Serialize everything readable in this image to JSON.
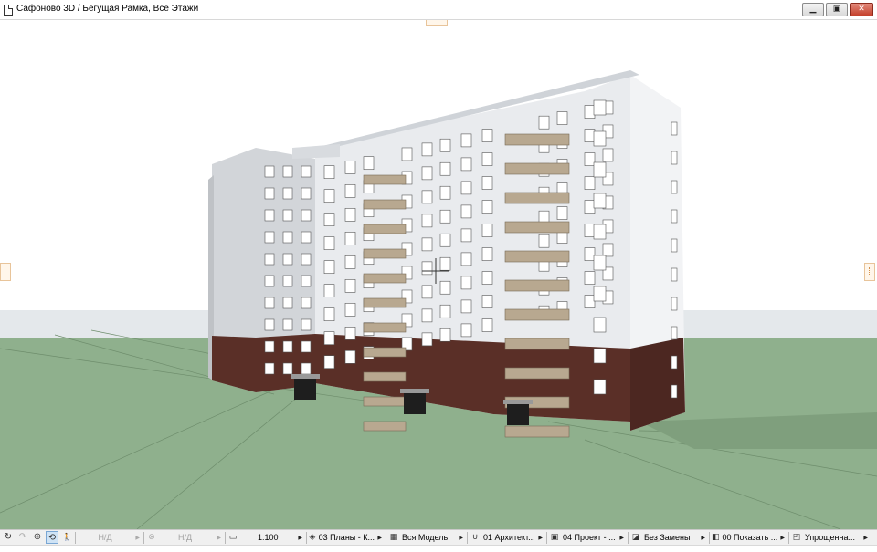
{
  "window": {
    "title": "Сафоново 3D / Бегущая Рамка, Все Этажи",
    "controls": {
      "minimize": "▁",
      "restore": "▣",
      "close": "✕"
    }
  },
  "icons": {
    "window_icon": "document-icon",
    "status_tools": [
      {
        "name": "rotate-icon",
        "glyph": "↻"
      },
      {
        "name": "redo-view-icon",
        "glyph": "↷"
      },
      {
        "name": "zoom-icon",
        "glyph": "⊕"
      },
      {
        "name": "orbit-icon",
        "glyph": "⟲"
      },
      {
        "name": "walk-icon",
        "glyph": "🚶"
      }
    ]
  },
  "statusbar": {
    "fields": [
      {
        "name": "status-nd-1",
        "icon": "",
        "label": "Н/Д",
        "disabled": true
      },
      {
        "name": "status-nd-2",
        "icon": "⊗",
        "label": "Н/Д",
        "disabled": true
      },
      {
        "name": "scale-selector",
        "icon": "▭",
        "label": "1:100",
        "disabled": false
      },
      {
        "name": "layer-combination",
        "icon": "◈",
        "label": "03 Планы - К...",
        "disabled": false
      },
      {
        "name": "model-view-option",
        "icon": "▦",
        "label": "Вся Модель",
        "disabled": false
      },
      {
        "name": "pen-set",
        "icon": "∪",
        "label": "01 Архитект...",
        "disabled": false
      },
      {
        "name": "model-view-combination",
        "icon": "▣",
        "label": "04 Проект - ...",
        "disabled": false
      },
      {
        "name": "graphic-override",
        "icon": "◪",
        "label": "Без Замены",
        "disabled": false
      },
      {
        "name": "renovation-filter",
        "icon": "◧",
        "label": "00 Показать ...",
        "disabled": false
      },
      {
        "name": "structure-display",
        "icon": "◰",
        "label": "Упрощенна...",
        "disabled": false
      }
    ]
  },
  "colors": {
    "sky": "#ffffff",
    "ground": "#8fb08d",
    "facade_light": "#e9ebee",
    "facade_shadow": "#d2d5d9",
    "brick": "#5a2f27",
    "balcony": "#b8a890"
  }
}
